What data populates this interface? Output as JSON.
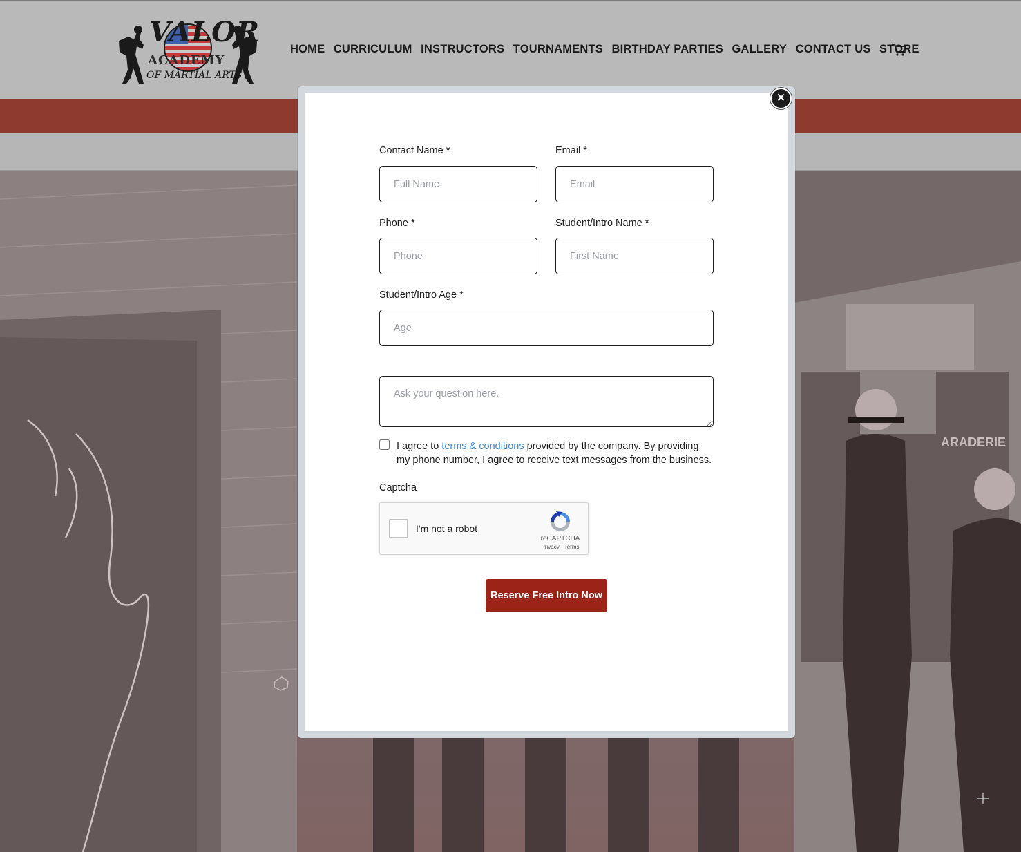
{
  "header": {
    "logo": {
      "text_top": "VALOR",
      "text_mid": "ACADEMY",
      "text_bottom": "OF MARTIAL ARTS"
    },
    "nav": [
      "HOME",
      "CURRICULUM",
      "INSTRUCTORS",
      "TOURNAMENTS",
      "BIRTHDAY PARTIES",
      "GALLERY",
      "CONTACT US",
      "STORE"
    ],
    "cart_icon": "shopping-cart-icon"
  },
  "hero": {
    "sign_text": "ARADERIE"
  },
  "modal": {
    "close_label": "×",
    "contact_name": {
      "label": "Contact Name *",
      "placeholder": "Full Name"
    },
    "email": {
      "label": "Email *",
      "placeholder": "Email"
    },
    "phone": {
      "label": "Phone *",
      "placeholder": "Phone"
    },
    "student_name": {
      "label": "Student/Intro Name *",
      "placeholder": "First Name"
    },
    "student_age": {
      "label": "Student/Intro Age *",
      "placeholder": "Age"
    },
    "question": {
      "placeholder": "Ask your question here."
    },
    "consent": {
      "prefix": "I agree to ",
      "link_text": "terms & conditions",
      "suffix": " provided by the company. By providing my phone number, I agree to receive text messages from the business."
    },
    "captcha": {
      "label": "Captcha",
      "checkbox_label": "I'm not a robot",
      "brand": "reCAPTCHA",
      "links": "Privacy - Terms"
    },
    "submit_label": "Reserve Free Intro Now"
  },
  "colors": {
    "brand_red": "#9b2318",
    "link_blue": "#3b8fd6",
    "header_bg": "#b9b9b9",
    "band_red": "#8f3a2e"
  }
}
